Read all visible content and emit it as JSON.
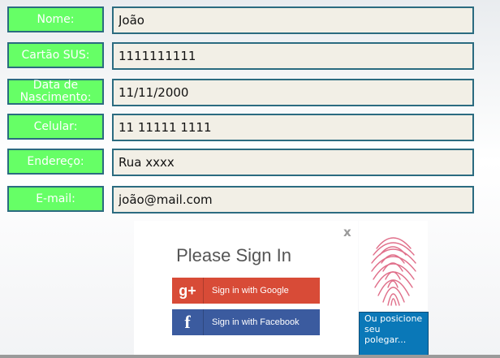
{
  "form": {
    "fields": [
      {
        "label": "Nome:",
        "value": "João"
      },
      {
        "label": "Cartão SUS:",
        "value": "1111111111"
      },
      {
        "label": "Data de Nascimento:",
        "value": "11/11/2000"
      },
      {
        "label": "Celular:",
        "value": "11 11111 1111"
      },
      {
        "label": "Endereço:",
        "value": "Rua xxxx"
      },
      {
        "label": "E-mail:",
        "value": "joão@mail.com"
      }
    ]
  },
  "signin": {
    "close": "x",
    "title": "Please Sign In",
    "google_icon": "g+",
    "google_label": "Sign in with Google",
    "facebook_icon": "f",
    "facebook_label": "Sign in with Facebook"
  },
  "fingerprint": {
    "icon": "fingerprint-icon",
    "hint": "Ou posicione seu polegar..."
  },
  "colors": {
    "label_bg": "#66ff66",
    "field_bg": "#f2efe6",
    "border": "#2b6b80",
    "google": "#d84b37",
    "facebook": "#3b5b9f",
    "hint_bg": "#0a78b8"
  }
}
